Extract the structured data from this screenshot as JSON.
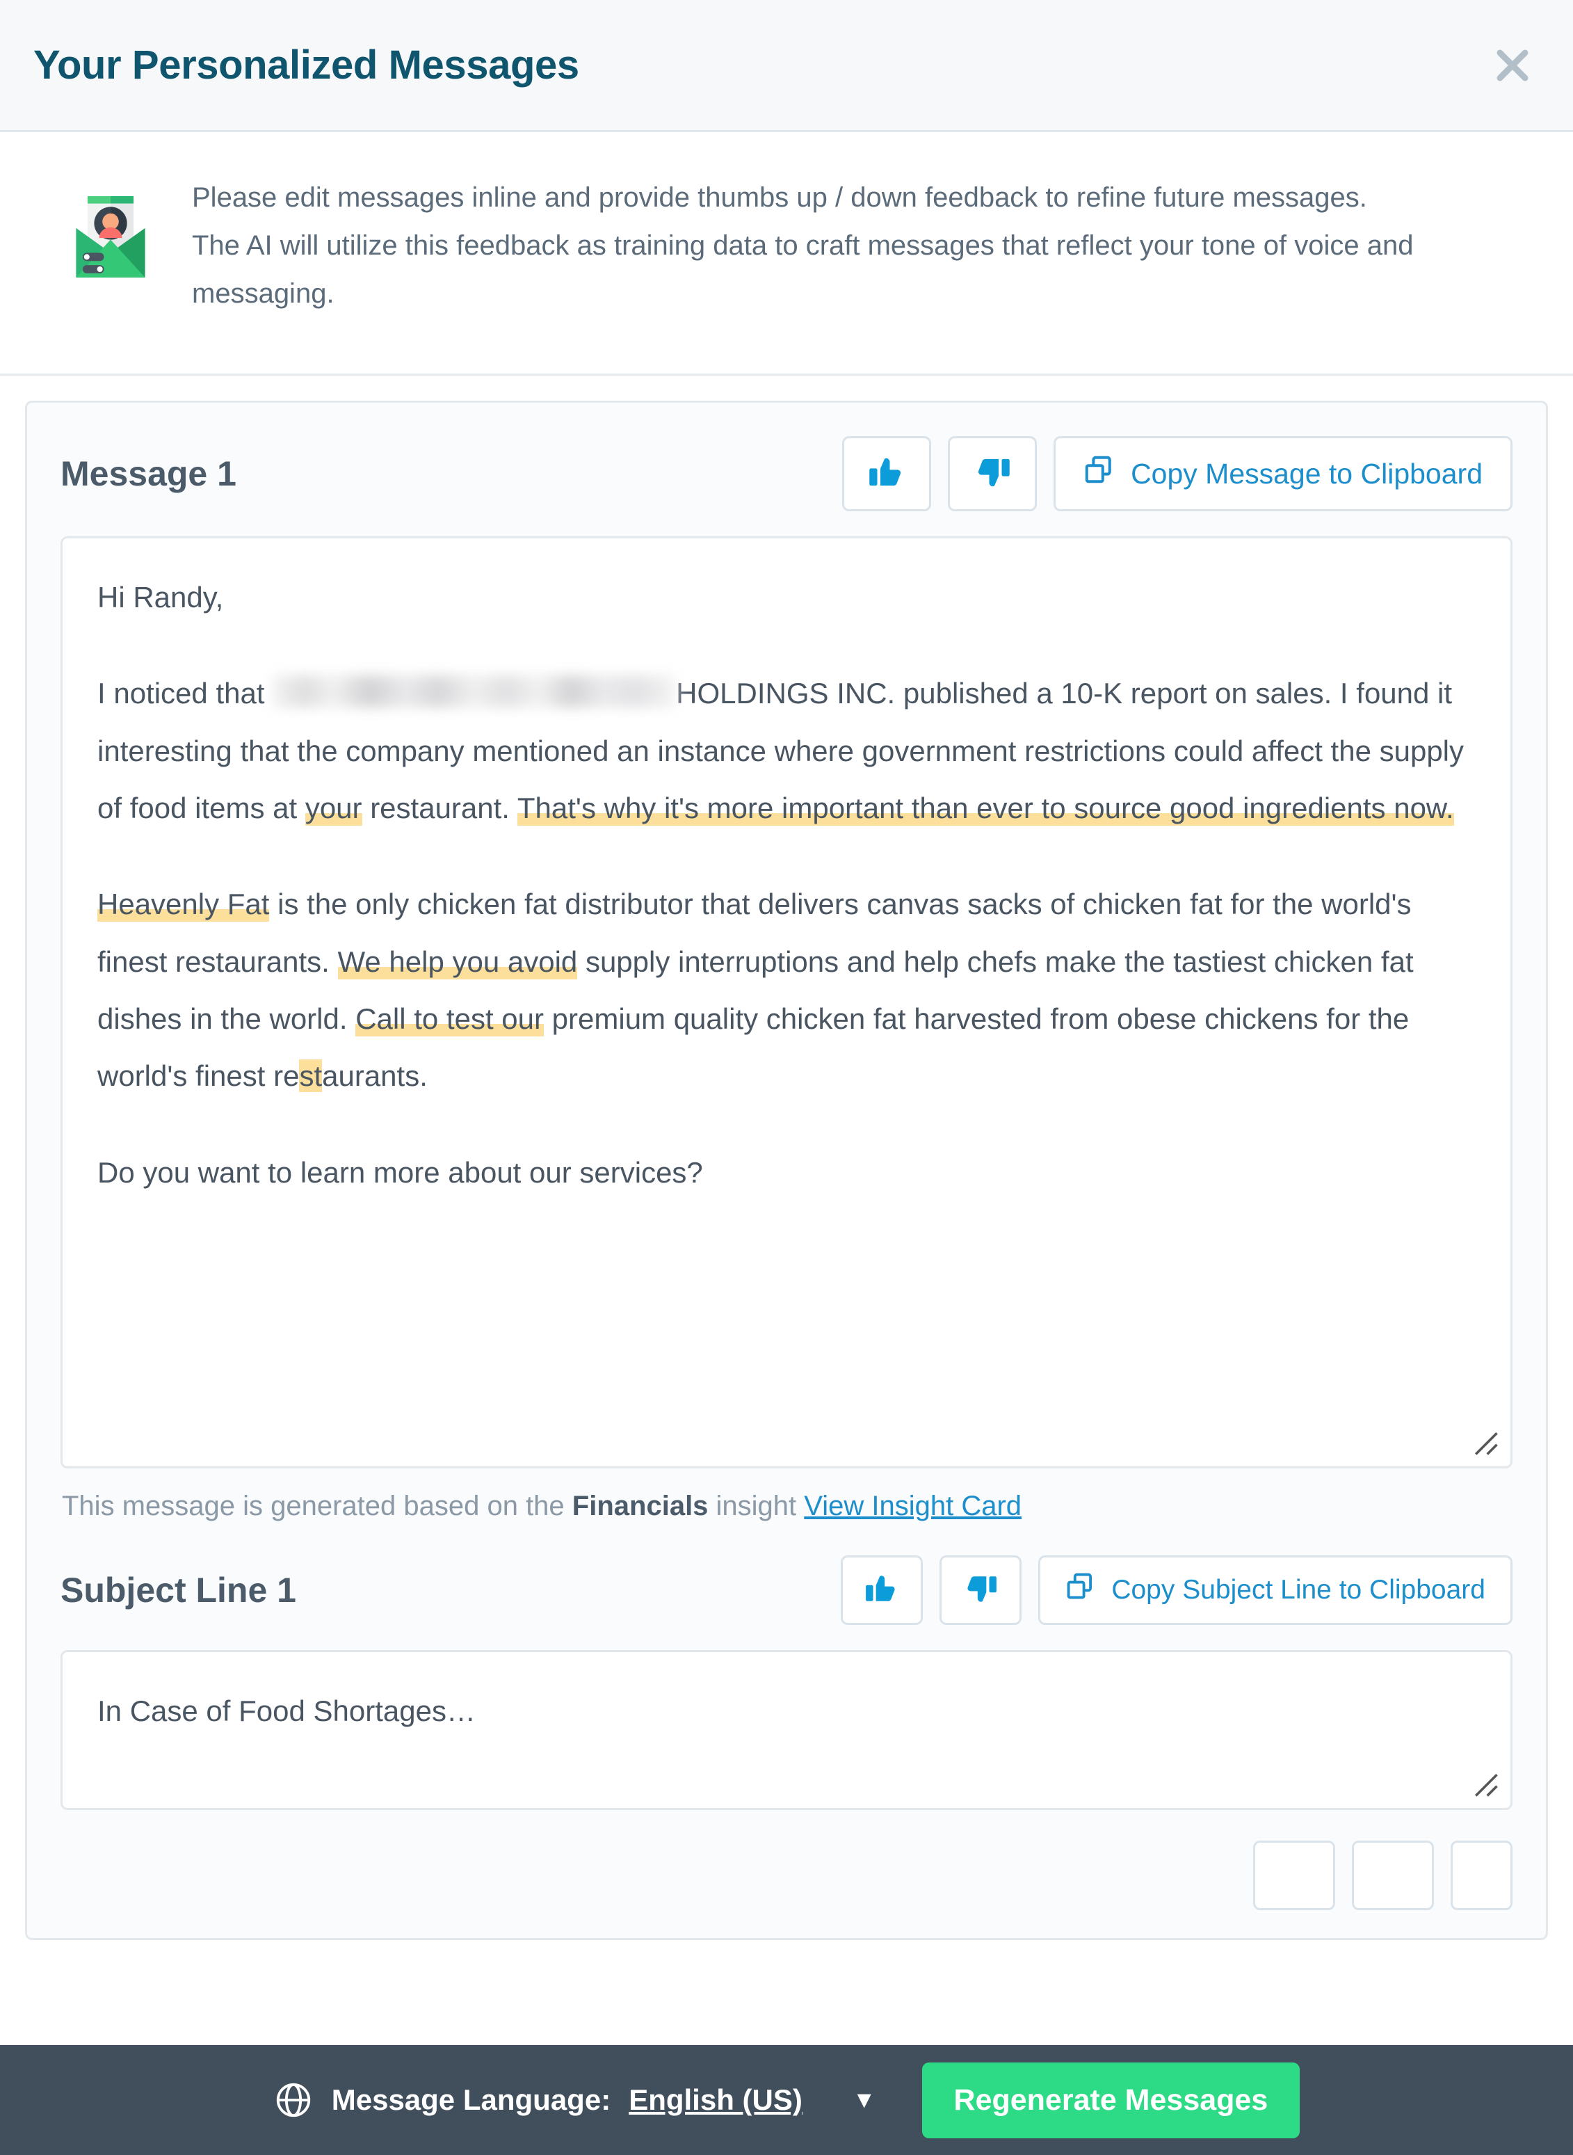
{
  "header": {
    "title": "Your Personalized Messages",
    "close_icon": "close-icon"
  },
  "info_banner": {
    "icon": "envelope-person-icon",
    "text": "Please edit messages inline and provide thumbs up / down feedback to refine future messages. The AI will utilize this feedback as training data to craft messages that reflect your tone of voice and messaging."
  },
  "message_section": {
    "title": "Message 1",
    "thumbs_up_icon": "thumbs-up-icon",
    "thumbs_down_icon": "thumbs-down-icon",
    "copy_label": "Copy Message to Clipboard",
    "copy_icon": "copy-icon",
    "greeting": "Hi Randy,",
    "p1_a": "I noticed that ",
    "p1_redacted": "",
    "p1_b": "HOLDINGS INC. published a 10-K report on sales. I found it interesting that the company mentioned an instance where government restrictions could affect the supply of food items at ",
    "p1_hl1": "your",
    "p1_c": " restaurant. ",
    "p1_hl2": "That's why it's more important than ever to source good ingredients now.",
    "p2_hl1": "Heavenly Fat",
    "p2_a": " is the only chicken fat distributor that delivers canvas sacks of chicken fat for the world's finest restaurants. ",
    "p2_hl2": "We help you avoid",
    "p2_b": " supply interruptions and help chefs make the tastiest chicken fat dishes in the world. ",
    "p2_hl3": "Call to test our",
    "p2_c": " premium quality chicken fat harvested from obese chickens for the world's finest re",
    "p2_hl4": "st",
    "p2_d": "aurants.",
    "p3": "Do you want to learn more about our services?",
    "caption_pre": "This message is generated based on the ",
    "caption_bold": "Financials",
    "caption_mid": " insight ",
    "caption_link": "View Insight Card"
  },
  "subject_section": {
    "title": "Subject Line 1",
    "thumbs_up_icon": "thumbs-up-icon",
    "thumbs_down_icon": "thumbs-down-icon",
    "copy_label": "Copy Subject Line to Clipboard",
    "copy_icon": "copy-icon",
    "value": "In Case of Food Shortages…"
  },
  "footer": {
    "globe_icon": "globe-icon",
    "language_label": "Message Language:",
    "language_value": "English (US)",
    "caret_icon": "chevron-down-icon",
    "regenerate_label": "Regenerate Messages"
  },
  "colors": {
    "title": "#10556e",
    "accent_link": "#1c8ecb",
    "highlight": "#fbdf9b",
    "footer_bg": "#414e5c",
    "regen_green": "#2ddb86"
  }
}
